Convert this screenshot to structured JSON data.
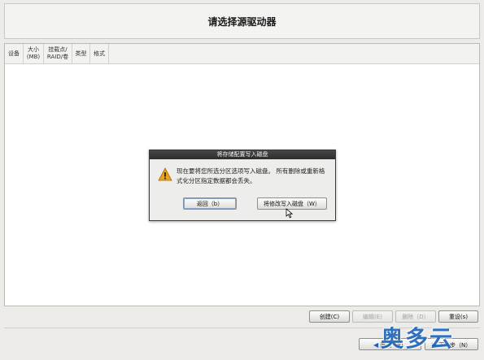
{
  "header": {
    "title": "请选择源驱动器"
  },
  "table": {
    "columns": [
      "设备",
      "大小\n(MB)",
      "挂载点/\nRAID/卷",
      "类型",
      "格式"
    ]
  },
  "dialog": {
    "title": "将存储配置写入磁盘",
    "message": "现在要将您所选分区选项写入磁盘。 所有删除或重新格式化分区指定数据都会丢失。",
    "back_label": "返回（b）",
    "write_label": "将修改写入磁盘（W）"
  },
  "toolbar": {
    "create_label": "创建(C)",
    "edit_label": "编辑(E)",
    "delete_label": "删除（D）",
    "reset_label": "重设(s)"
  },
  "nav": {
    "back_label": "返回（B）",
    "next_label": "下一步（N）"
  },
  "watermark": {
    "text": "奥多云"
  },
  "colors": {
    "accent": "#1c63b8",
    "dialog_title_bg": "#333333",
    "warning": "#e8a21b"
  }
}
